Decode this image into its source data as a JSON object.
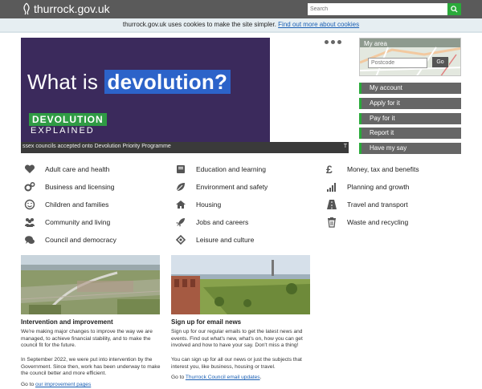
{
  "header": {
    "logo_text": "thurrock.gov.uk",
    "search_placeholder": "Search"
  },
  "cookie_bar": {
    "text": "thurrock.gov.uk uses cookies to make the site simpler.",
    "link": "Find out more about cookies"
  },
  "hero": {
    "title_plain": "What is",
    "title_highlight": "devolution?",
    "badge_line1": "DEVOLUTION",
    "badge_line2": "EXPLAINED",
    "ticker_text": "ssex councils accepted onto Devolution Priority Programme",
    "ticker_next": "T"
  },
  "my_area": {
    "title": "My area",
    "postcode_placeholder": "Postcode",
    "go_label": "Go"
  },
  "side_buttons": [
    "My account",
    "Apply for it",
    "Pay for it",
    "Report it",
    "Have my say"
  ],
  "services": [
    {
      "label": "Adult care and health",
      "icon": "heart-icon"
    },
    {
      "label": "Education and learning",
      "icon": "book-icon"
    },
    {
      "label": "Money, tax and benefits",
      "icon": "pound-icon"
    },
    {
      "label": "Business and licensing",
      "icon": "gears-icon"
    },
    {
      "label": "Environment and safety",
      "icon": "leaf-icon"
    },
    {
      "label": "Planning and growth",
      "icon": "bar-chart-icon"
    },
    {
      "label": "Children and families",
      "icon": "smile-icon"
    },
    {
      "label": "Housing",
      "icon": "house-icon"
    },
    {
      "label": "Travel and transport",
      "icon": "road-icon"
    },
    {
      "label": "Community and living",
      "icon": "people-icon"
    },
    {
      "label": "Jobs and careers",
      "icon": "rocket-icon"
    },
    {
      "label": "Waste and recycling",
      "icon": "bin-icon"
    },
    {
      "label": "Council and democracy",
      "icon": "speech-icon"
    },
    {
      "label": "Leisure and culture",
      "icon": "ticket-icon"
    }
  ],
  "cards": [
    {
      "title": "Intervention and improvement",
      "p1": "We're making major changes to improve the way we are managed, to achieve financial stability, and to make the council fit for the future.",
      "p2": "In September 2022, we were put into intervention by the Government. Since then, work has been underway to make the council better and more efficient.",
      "p3_prefix": "Go to",
      "p3_link": "our improvement pages"
    },
    {
      "title": "Sign up for email news",
      "p1": "Sign up for our regular emails to get the latest news and events. Find out what's new, what's on, how you can get involved and how to have your say. Don't miss a thing!",
      "p2": "You can sign up for all our news or just the subjects that interest you, like business, housing or travel.",
      "p3_prefix": "Go to",
      "p3_link": "Thurrock Council email updates",
      "p3_suffix": "."
    }
  ]
}
